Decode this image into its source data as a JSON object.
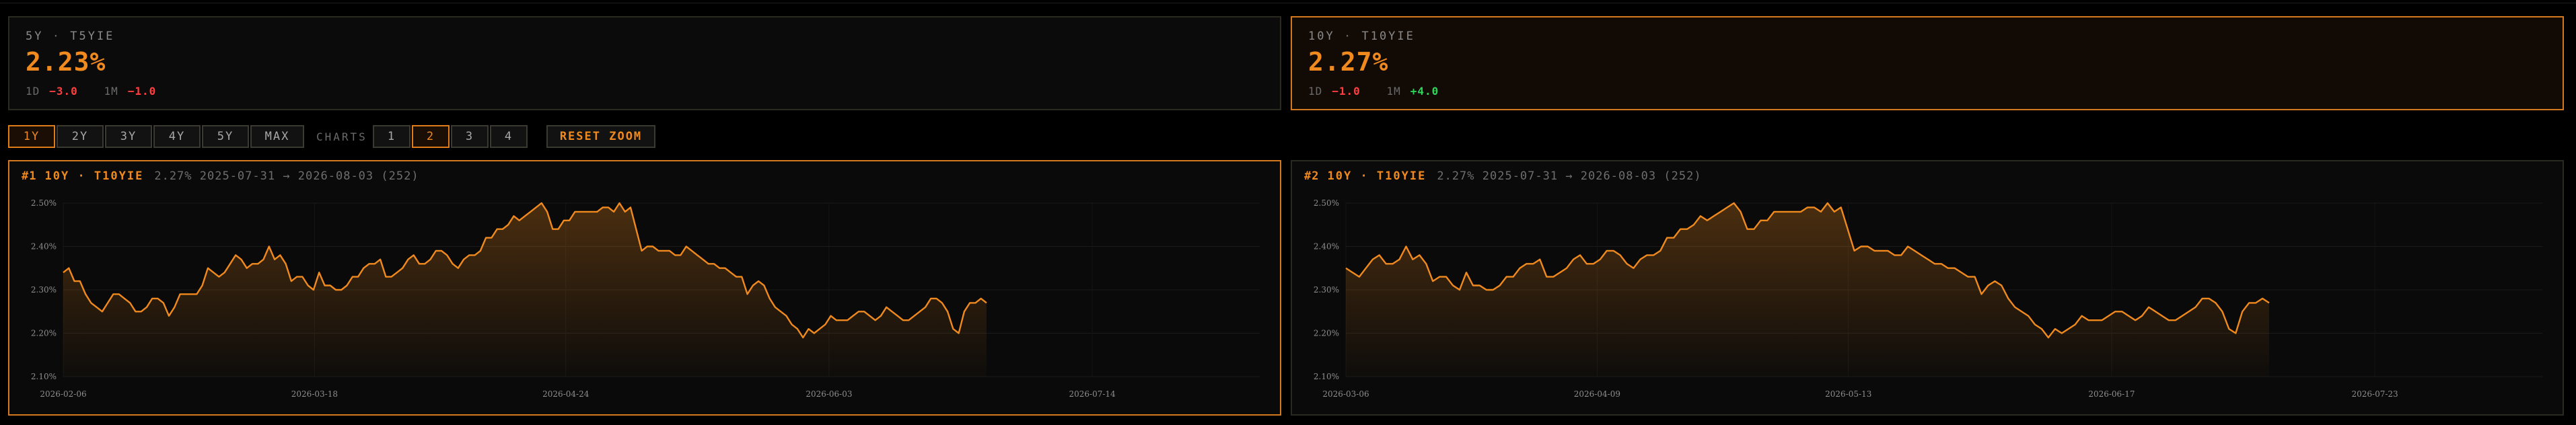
{
  "cards": [
    {
      "tenor": "5Y",
      "symbol": "T5YIE",
      "value": "2.23%",
      "d1_label": "1D",
      "d1": "−3.0",
      "m1_label": "1M",
      "m1": "−1.0"
    },
    {
      "tenor": "10Y",
      "symbol": "T10YIE",
      "value": "2.27%",
      "d1_label": "1D",
      "d1": "−1.0",
      "m1_label": "1M",
      "m1": "+4.0"
    }
  ],
  "controls": {
    "ranges": [
      "1Y",
      "2Y",
      "3Y",
      "4Y",
      "5Y",
      "MAX"
    ],
    "active_range": "1Y",
    "charts_label": "CHARTS",
    "chart_counts": [
      "1",
      "2",
      "3",
      "4"
    ],
    "active_count": "2",
    "reset_label": "RESET ZOOM"
  },
  "panels": [
    {
      "number": "#1",
      "tenor": "10Y",
      "symbol": "T10YIE",
      "meta": "2.27% 2025-07-31 → 2026-08-03 (252)"
    },
    {
      "number": "#2",
      "tenor": "10Y",
      "symbol": "T10YIE",
      "meta": "2.27% 2025-07-31 → 2026-08-03 (252)"
    }
  ],
  "colors": {
    "accent": "#f08a1e",
    "negative": "#ff3f3f",
    "positive": "#2fd35a"
  },
  "chart_data": [
    {
      "type": "area",
      "y_tick_labels": [
        "2.50%",
        "2.40%",
        "2.30%",
        "2.20%",
        "2.10%"
      ],
      "y_ticks": [
        2.5,
        2.4,
        2.3,
        2.2,
        2.1
      ],
      "ylim": [
        2.1,
        2.5
      ],
      "x_tick_labels": [
        "2026-02-06",
        "2026-03-18",
        "2026-04-24",
        "2026-06-03",
        "2026-07-14"
      ],
      "x_ticks_fraction": [
        0.0,
        0.21,
        0.42,
        0.64,
        0.86
      ],
      "grid": true,
      "series": [
        {
          "values": [
            2.34,
            2.35,
            2.32,
            2.32,
            2.29,
            2.27,
            2.26,
            2.25,
            2.27,
            2.29,
            2.29,
            2.28,
            2.27,
            2.25,
            2.25,
            2.26,
            2.28,
            2.28,
            2.27,
            2.24,
            2.26,
            2.29,
            2.29,
            2.29,
            2.29,
            2.31,
            2.35,
            2.34,
            2.33,
            2.34,
            2.36,
            2.38,
            2.37,
            2.35,
            2.36,
            2.36,
            2.37,
            2.4,
            2.37,
            2.38,
            2.36,
            2.32,
            2.33,
            2.33,
            2.31,
            2.3,
            2.34,
            2.31,
            2.31,
            2.3,
            2.3,
            2.31,
            2.33,
            2.33,
            2.35,
            2.36,
            2.36,
            2.37,
            2.33,
            2.33,
            2.34,
            2.35,
            2.37,
            2.38,
            2.36,
            2.36,
            2.37,
            2.39,
            2.39,
            2.38,
            2.36,
            2.35,
            2.37,
            2.38,
            2.38,
            2.39,
            2.42,
            2.42,
            2.44,
            2.44,
            2.45,
            2.47,
            2.46,
            2.47,
            2.48,
            2.49,
            2.5,
            2.48,
            2.44,
            2.44,
            2.46,
            2.46,
            2.48,
            2.48,
            2.48,
            2.48,
            2.48,
            2.49,
            2.49,
            2.48,
            2.5,
            2.48,
            2.49,
            2.44,
            2.39,
            2.4,
            2.4,
            2.39,
            2.39,
            2.39,
            2.38,
            2.38,
            2.4,
            2.39,
            2.38,
            2.37,
            2.36,
            2.36,
            2.35,
            2.35,
            2.34,
            2.33,
            2.33,
            2.29,
            2.31,
            2.32,
            2.31,
            2.28,
            2.26,
            2.25,
            2.24,
            2.22,
            2.21,
            2.19,
            2.21,
            2.2,
            2.21,
            2.22,
            2.24,
            2.23,
            2.23,
            2.23,
            2.24,
            2.25,
            2.25,
            2.24,
            2.23,
            2.24,
            2.26,
            2.25,
            2.24,
            2.23,
            2.23,
            2.24,
            2.25,
            2.26,
            2.28,
            2.28,
            2.27,
            2.25,
            2.21,
            2.2,
            2.25,
            2.27,
            2.27,
            2.28,
            2.27
          ]
        }
      ]
    },
    {
      "type": "area",
      "y_tick_labels": [
        "2.50%",
        "2.40%",
        "2.30%",
        "2.20%",
        "2.10%"
      ],
      "y_ticks": [
        2.5,
        2.4,
        2.3,
        2.2,
        2.1
      ],
      "ylim": [
        2.1,
        2.5
      ],
      "x_tick_labels": [
        "2026-03-06",
        "2026-04-09",
        "2026-05-13",
        "2026-06-17",
        "2026-07-23"
      ],
      "x_ticks_fraction": [
        0.0,
        0.21,
        0.42,
        0.64,
        0.86
      ],
      "grid": true,
      "series": [
        {
          "values": [
            2.35,
            2.34,
            2.33,
            2.35,
            2.37,
            2.38,
            2.36,
            2.36,
            2.37,
            2.4,
            2.37,
            2.38,
            2.36,
            2.32,
            2.33,
            2.33,
            2.31,
            2.3,
            2.34,
            2.31,
            2.31,
            2.3,
            2.3,
            2.31,
            2.33,
            2.33,
            2.35,
            2.36,
            2.36,
            2.37,
            2.33,
            2.33,
            2.34,
            2.35,
            2.37,
            2.38,
            2.36,
            2.36,
            2.37,
            2.39,
            2.39,
            2.38,
            2.36,
            2.35,
            2.37,
            2.38,
            2.38,
            2.39,
            2.42,
            2.42,
            2.44,
            2.44,
            2.45,
            2.47,
            2.46,
            2.47,
            2.48,
            2.49,
            2.5,
            2.48,
            2.44,
            2.44,
            2.46,
            2.46,
            2.48,
            2.48,
            2.48,
            2.48,
            2.48,
            2.49,
            2.49,
            2.48,
            2.5,
            2.48,
            2.49,
            2.44,
            2.39,
            2.4,
            2.4,
            2.39,
            2.39,
            2.39,
            2.38,
            2.38,
            2.4,
            2.39,
            2.38,
            2.37,
            2.36,
            2.36,
            2.35,
            2.35,
            2.34,
            2.33,
            2.33,
            2.29,
            2.31,
            2.32,
            2.31,
            2.28,
            2.26,
            2.25,
            2.24,
            2.22,
            2.21,
            2.19,
            2.21,
            2.2,
            2.21,
            2.22,
            2.24,
            2.23,
            2.23,
            2.23,
            2.24,
            2.25,
            2.25,
            2.24,
            2.23,
            2.24,
            2.26,
            2.25,
            2.24,
            2.23,
            2.23,
            2.24,
            2.25,
            2.26,
            2.28,
            2.28,
            2.27,
            2.25,
            2.21,
            2.2,
            2.25,
            2.27,
            2.27,
            2.28,
            2.27
          ]
        }
      ]
    }
  ]
}
